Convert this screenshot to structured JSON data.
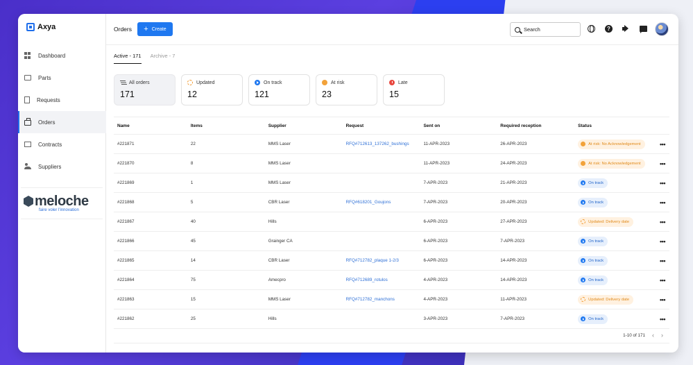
{
  "app": {
    "name": "Axya"
  },
  "sidebar": {
    "items": [
      {
        "label": "Dashboard",
        "icon": "dashboard-icon"
      },
      {
        "label": "Parts",
        "icon": "folder-icon"
      },
      {
        "label": "Requests",
        "icon": "document-icon"
      },
      {
        "label": "Orders",
        "icon": "bag-icon",
        "active": true
      },
      {
        "label": "Contracts",
        "icon": "contract-icon"
      },
      {
        "label": "Suppliers",
        "icon": "users-icon"
      }
    ],
    "brand": {
      "name": "meloche",
      "tagline": "faire voler l'innovation"
    }
  },
  "header": {
    "title": "Orders",
    "create_label": "Create",
    "search_placeholder": "Search",
    "help_glyph": "?"
  },
  "tabs": [
    {
      "label": "Active - 171",
      "active": true
    },
    {
      "label": "Archive - 7",
      "active": false
    }
  ],
  "cards": [
    {
      "label": "All orders",
      "value": "171",
      "icon": "filter-icon"
    },
    {
      "label": "Updated",
      "value": "12",
      "icon": "updated-icon"
    },
    {
      "label": "On track",
      "value": "121",
      "icon": "on-track-icon"
    },
    {
      "label": "At risk",
      "value": "23",
      "icon": "at-risk-icon"
    },
    {
      "label": "Late",
      "value": "15",
      "icon": "late-icon"
    }
  ],
  "table": {
    "columns": [
      "Name",
      "Items",
      "Supplier",
      "Request",
      "Sent on",
      "Required reception",
      "Status"
    ],
    "rows": [
      {
        "name": "#221871",
        "items": "22",
        "supplier": "MMS Laser",
        "request": "RFQ#712613_137262_bushings",
        "sent": "11-APR-2023",
        "required": "26-APR-2023",
        "status": "At risk: No Acknowledgement",
        "status_type": "risk"
      },
      {
        "name": "#221870",
        "items": "8",
        "supplier": "MMS Laser",
        "request": "",
        "sent": "11-APR-2023",
        "required": "24-APR-2023",
        "status": "At risk: No Acknowledgement",
        "status_type": "risk"
      },
      {
        "name": "#221869",
        "items": "1",
        "supplier": "MMS Laser",
        "request": "",
        "sent": "7-APR-2023",
        "required": "21-APR-2023",
        "status": "On track",
        "status_type": "track"
      },
      {
        "name": "#221868",
        "items": "5",
        "supplier": "CBR Laser",
        "request": "RFQ#618201_Goujons",
        "sent": "7-APR-2023",
        "required": "20-APR-2023",
        "status": "On track",
        "status_type": "track"
      },
      {
        "name": "#221867",
        "items": "40",
        "supplier": "Hills",
        "request": "",
        "sent": "6-APR-2023",
        "required": "27-APR-2023",
        "status": "Updated: Delivery date",
        "status_type": "upd"
      },
      {
        "name": "#221866",
        "items": "45",
        "supplier": "Grainger CA",
        "request": "",
        "sent": "6-APR-2023",
        "required": "7-APR-2023",
        "status": "On track",
        "status_type": "track"
      },
      {
        "name": "#221865",
        "items": "14",
        "supplier": "CBR Laser",
        "request": "RFQ#712782_plaque 1-2/3",
        "sent": "6-APR-2023",
        "required": "14-APR-2023",
        "status": "On track",
        "status_type": "track"
      },
      {
        "name": "#221864",
        "items": "75",
        "supplier": "Amecpro",
        "request": "RFQ#712689_rotulos",
        "sent": "4-APR-2023",
        "required": "14-APR-2023",
        "status": "On track",
        "status_type": "track"
      },
      {
        "name": "#221863",
        "items": "15",
        "supplier": "MMS Laser",
        "request": "RFQ#712782_manchons",
        "sent": "4-APR-2023",
        "required": "11-APR-2023",
        "status": "Updated: Delivery date",
        "status_type": "upd"
      },
      {
        "name": "#221862",
        "items": "25",
        "supplier": "Hills",
        "request": "",
        "sent": "3-APR-2023",
        "required": "7-APR-2023",
        "status": "On track",
        "status_type": "track"
      }
    ],
    "more_glyph": "•••"
  },
  "pagination": {
    "range": "1-10 of 171",
    "prev": "‹",
    "next": "›"
  },
  "colors": {
    "accent": "#1f78f0",
    "at_risk": "#f2a23a",
    "late": "#e8473e",
    "updated": "#f29a2e"
  }
}
